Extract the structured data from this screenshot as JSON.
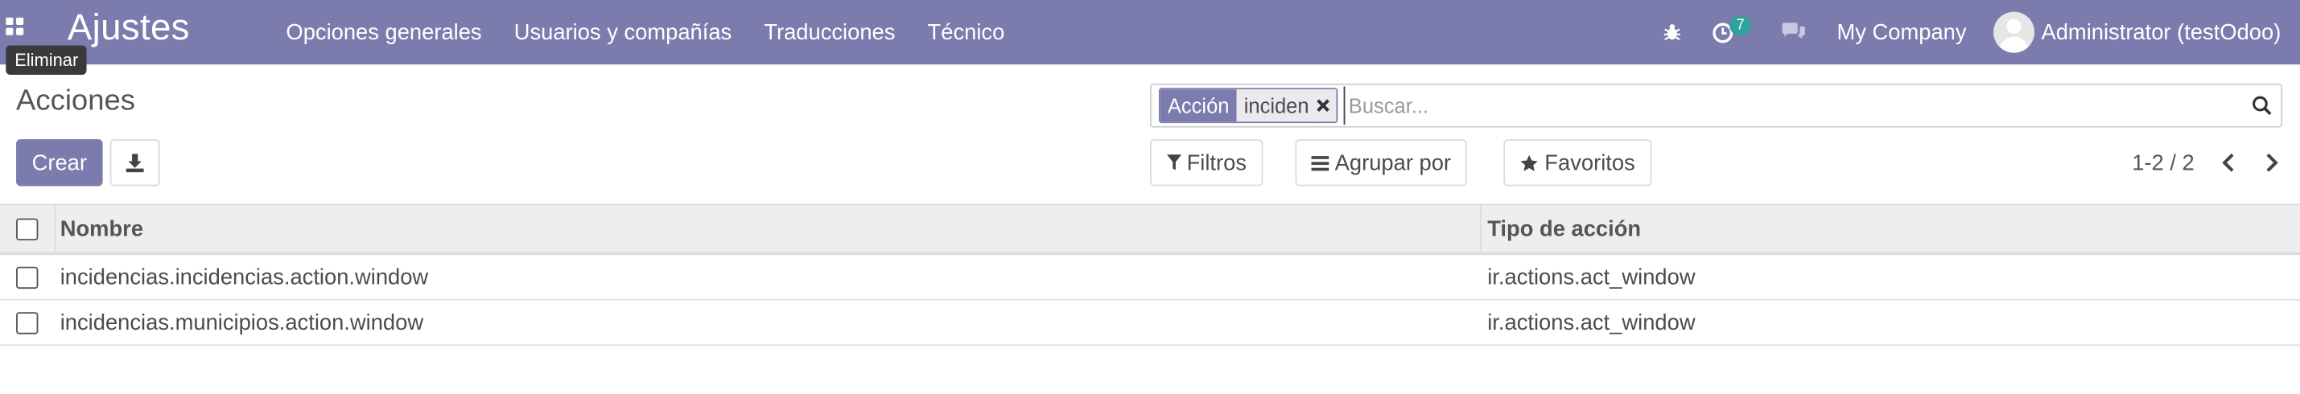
{
  "topbar": {
    "apps_icon": "grid-icon",
    "brand": "Ajustes",
    "menu": [
      "Opciones generales",
      "Usuarios y compañías",
      "Traducciones",
      "Técnico"
    ],
    "debug_icon": "bug-icon",
    "activity_icon": "clock-icon",
    "activity_count": "7",
    "messages_icon": "chat-bubbles-icon",
    "company": "My Company",
    "user_name": "Administrator (testOdoo)",
    "accent_color": "#7c7bad"
  },
  "tooltip": "Eliminar",
  "control_panel": {
    "title": "Acciones",
    "create_label": "Crear",
    "download_icon": "download-icon",
    "search": {
      "facet_label": "Acción",
      "facet_value": "inciden",
      "placeholder": "Buscar..."
    },
    "filters_label": "Filtros",
    "group_by_label": "Agrupar por",
    "favorites_label": "Favoritos",
    "pager": "1-2 / 2"
  },
  "table": {
    "columns": [
      "Nombre",
      "Tipo de acción"
    ],
    "rows": [
      [
        "incidencias.incidencias.action.window",
        "ir.actions.act_window"
      ],
      [
        "incidencias.municipios.action.window",
        "ir.actions.act_window"
      ]
    ]
  }
}
